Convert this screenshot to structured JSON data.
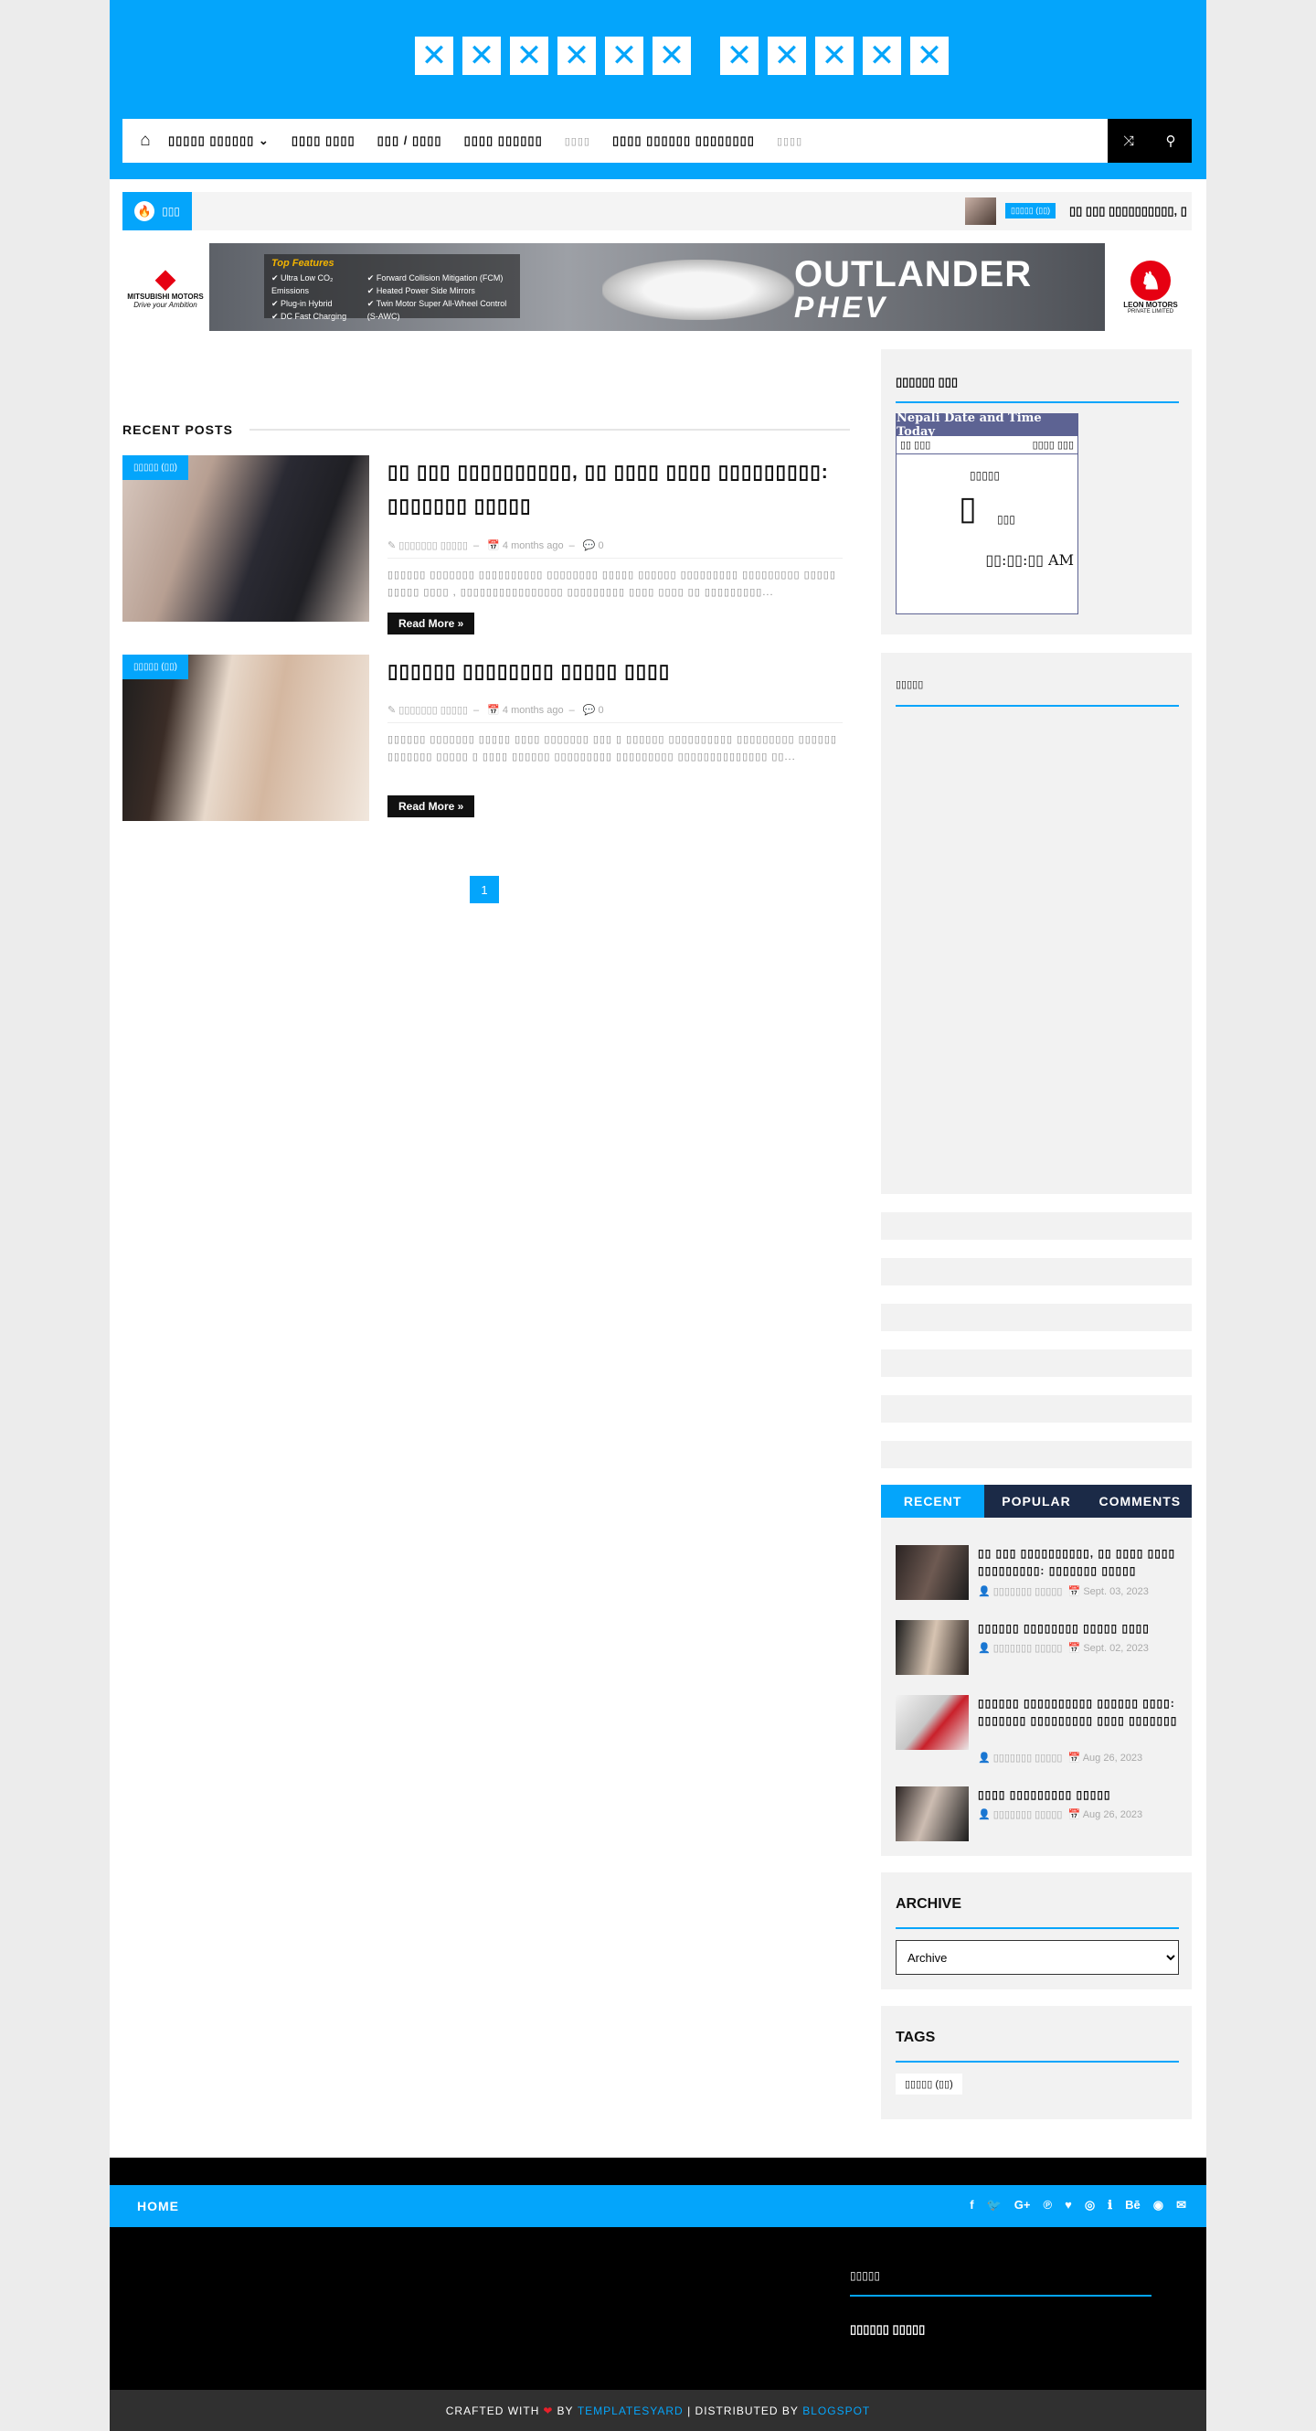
{
  "site": {
    "title_glyphs": [
      "✕",
      "✕",
      "✕",
      "✕",
      "✕",
      "✕",
      "",
      "✕",
      "✕",
      "✕",
      "✕",
      "✕"
    ]
  },
  "nav": {
    "home_icon": "home-icon",
    "items": [
      {
        "label": "▯▯▯▯▯ ▯▯▯▯▯▯ ⌄",
        "light": false
      },
      {
        "label": "▯▯▯▯ ▯▯▯▯",
        "light": false
      },
      {
        "label": "▯▯▯ / ▯▯▯▯",
        "light": false
      },
      {
        "label": "▯▯▯▯ ▯▯▯▯▯▯",
        "light": false
      },
      {
        "label": "▯▯▯▯",
        "light": true
      },
      {
        "label": "▯▯▯▯ ▯▯▯▯▯▯ ▯▯▯▯▯▯▯▯",
        "light": false
      },
      {
        "label": "▯▯▯▯",
        "light": true
      }
    ],
    "shuffle_icon": "⤨",
    "search_icon": "⚲"
  },
  "ticker": {
    "label": "▯▯▯",
    "category": "▯▯▯▯▯ (▯▯)",
    "text": "▯▯ ▯▯▯ ▯▯▯▯▯▯▯▯▯▯, ▯"
  },
  "ad": {
    "left_brand": "MITSUBISHI MOTORS",
    "left_tagline": "Drive your Ambition",
    "features_title": "Top Features",
    "features_col1": [
      "✔ Ultra Low CO₂ Emissions",
      "✔ Plug-in Hybrid",
      "✔ DC Fast Charging"
    ],
    "features_col2": [
      "✔ Forward Collision Mitigation (FCM)",
      "✔ Heated Power Side Mirrors",
      "✔ Twin Motor Super All-Wheel Control (S-AWC)"
    ],
    "product": "OUTLANDER",
    "product_sub": "PHEV",
    "right_brand": "LEON MOTORS",
    "right_sub": "PRIVATE LIMITED"
  },
  "main": {
    "section_title": "RECENT POSTS",
    "posts": [
      {
        "category": "▯▯▯▯▯ (▯▯)",
        "title": "▯▯ ▯▯▯ ▯▯▯▯▯▯▯▯▯▯, ▯▯ ▯▯▯▯ ▯▯▯▯ ▯▯▯▯▯▯▯▯▯: ▯▯▯▯▯▯▯ ▯▯▯▯▯",
        "author": "✎ ▯▯▯▯▯▯▯ ▯▯▯▯▯",
        "date": "📅 4 months ago",
        "comments": "💬 0",
        "excerpt": " ▯▯▯▯▯▯  ▯▯▯▯▯▯▯ ▯▯▯▯▯▯▯▯▯▯ ▯▯▯▯▯▯▯▯ ▯▯▯▯▯ ▯▯▯▯▯▯ ▯▯▯▯▯▯▯▯▯  ▯▯▯▯▯▯▯▯▯ ▯▯▯▯▯ ▯▯▯▯▯ ▯▯▯▯ , ▯▯▯▯▯▯▯▯▯▯▯▯▯▯▯▯ ▯▯▯▯▯▯▯▯▯ ▯▯▯▯ ▯▯▯▯ ▯▯ ▯▯▯▯▯▯▯▯▯...",
        "more": "Read More »"
      },
      {
        "category": "▯▯▯▯▯ (▯▯)",
        "title": "▯▯▯▯▯▯ ▯▯▯▯▯▯▯▯ ▯▯▯▯▯ ▯▯▯▯",
        "author": "✎ ▯▯▯▯▯▯▯ ▯▯▯▯▯",
        "date": "📅 4 months ago",
        "comments": "💬 0",
        "excerpt": "▯▯▯▯▯▯ ▯▯▯▯▯▯▯ ▯▯▯▯▯ ▯▯▯▯ ▯▯▯▯▯▯▯ ▯▯▯ ▯ ▯▯▯▯▯▯ ▯▯▯▯▯▯▯▯▯▯ ▯▯▯▯▯▯▯▯▯ ▯▯▯▯▯▯ ▯▯▯▯▯▯▯ ▯▯▯▯▯ ▯ ▯▯▯▯ ▯▯▯▯▯▯ ▯▯▯▯▯▯▯▯▯ ▯▯▯▯▯▯▯▯▯ ▯▯▯▯▯▯▯▯▯▯▯▯▯▯ ▯▯...",
        "more": "Read More »"
      }
    ],
    "page": "1"
  },
  "sidebar": {
    "widget1_title": "▯▯▯▯▯▯ ▯▯▯",
    "dt_header": "Nepali Date and Time Today",
    "dt_left": "▯▯ ▯▯▯",
    "dt_right": "▯▯▯▯ ▯▯▯",
    "dt_day": "▯▯▯▯▯",
    "dt_date": "▯",
    "dt_month": "▯▯▯",
    "dt_time": "▯▯:▯▯:▯▯ AM",
    "widget2_title": "▯▯▯▯▯",
    "tabs": [
      "RECENT",
      "POPULAR",
      "COMMENTS"
    ],
    "recent_items": [
      {
        "title": "▯▯ ▯▯▯ ▯▯▯▯▯▯▯▯▯▯, ▯▯ ▯▯▯▯ ▯▯▯▯ ▯▯▯▯▯▯▯▯▯: ▯▯▯▯▯▯▯ ▯▯▯▯▯",
        "author": "👤 ▯▯▯▯▯▯▯ ▯▯▯▯▯",
        "date": "📅 Sept. 03, 2023"
      },
      {
        "title": "▯▯▯▯▯▯ ▯▯▯▯▯▯▯▯ ▯▯▯▯▯ ▯▯▯▯",
        "author": "👤 ▯▯▯▯▯▯▯ ▯▯▯▯▯",
        "date": "📅 Sept. 02, 2023"
      },
      {
        "title": "▯▯▯▯▯▯ ▯▯▯▯▯▯▯▯▯▯ ▯▯▯▯▯▯ ▯▯▯▯: ▯▯▯▯▯▯▯ ▯▯▯▯▯▯▯▯▯ ▯▯▯▯ ▯▯▯▯▯▯▯",
        "author": "👤 ▯▯▯▯▯▯▯ ▯▯▯▯▯",
        "date": "📅 Aug 26, 2023"
      },
      {
        "title": "▯▯▯▯ ▯▯▯▯▯▯▯▯▯ ▯▯▯▯▯",
        "author": "👤 ▯▯▯▯▯▯▯ ▯▯▯▯▯",
        "date": "📅 Aug 26, 2023"
      }
    ],
    "archive_title": "ARCHIVE",
    "archive_select": "Archive",
    "tags_title": "TAGS",
    "tag": "▯▯▯▯▯ (▯▯)"
  },
  "footer": {
    "home": "HOME",
    "socials": [
      "f",
      "🐦",
      "G+",
      "℗",
      "♥",
      "◎",
      "ℹ",
      "Bē",
      "◉",
      "✉"
    ],
    "widget_title": "▯▯▯▯▯",
    "link": "▯▯▯▯▯▯ ▯▯▯▯▯",
    "crafted": "CRAFTED WITH",
    "by": "BY",
    "templatesyard": "TEMPLATESYARD",
    "distributed": "| DISTRIBUTED BY",
    "blogspot": "BLOGSPOT"
  },
  "colors": {
    "accent": "#04a5fb",
    "dark_nav": "#1b2a47"
  }
}
